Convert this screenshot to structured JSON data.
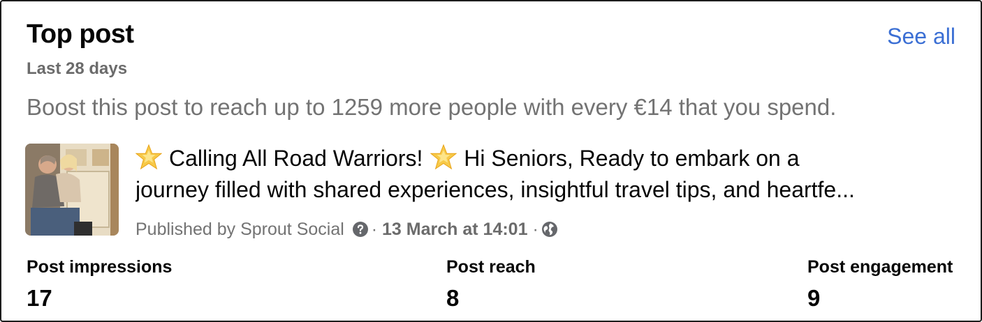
{
  "card": {
    "title": "Top post",
    "see_all": "See all",
    "period": "Last 28 days",
    "boost_text": "Boost this post to reach up to 1259 more people with every €14 that you spend."
  },
  "post": {
    "text_line1_part1": "Calling All Road Warriors!",
    "text_line1_part2": "Hi Seniors, Ready to embark on a",
    "text_line2": "journey filled with shared experiences, insightful travel tips, and heartfe...",
    "publisher_prefix": "Published by Sprout Social",
    "separator": "·",
    "date": "13 March at 14:01",
    "icons": [
      "star-emoji",
      "help-icon",
      "globe-icon"
    ]
  },
  "stats": [
    {
      "label": "Post impressions",
      "value": "17"
    },
    {
      "label": "Post reach",
      "value": "8"
    },
    {
      "label": "Post engagement",
      "value": "9"
    }
  ],
  "colors": {
    "link": "#3b6fd4",
    "primary_text": "#050505",
    "secondary_text": "#737373"
  }
}
